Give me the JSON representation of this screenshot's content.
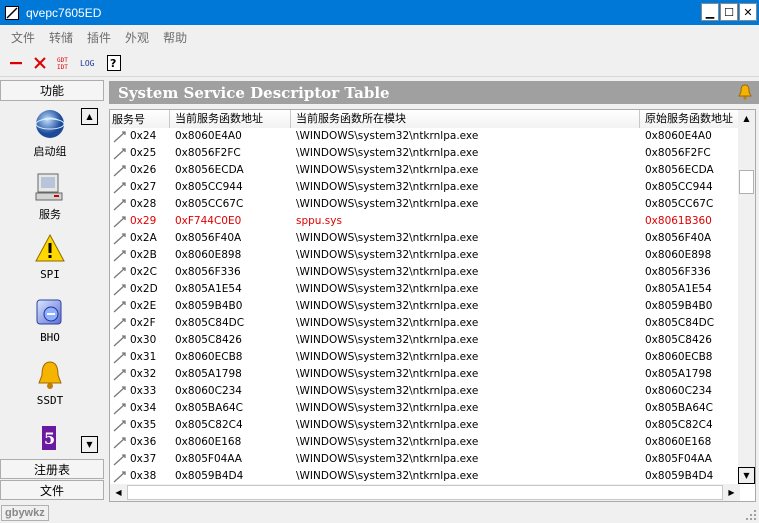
{
  "window": {
    "title": "qvepc7605ED",
    "min": "▁",
    "max": "☐",
    "close": "✕"
  },
  "menu": [
    "文件",
    "转储",
    "插件",
    "外观",
    "帮助"
  ],
  "toolbar": {
    "gdt_idt": "GDT IDT",
    "log": "LOG",
    "help": "?"
  },
  "sidebar": {
    "header": "功能",
    "items": [
      {
        "label": "启动组",
        "icon": "globe-icon"
      },
      {
        "label": "服务",
        "icon": "computer-icon"
      },
      {
        "label": "SPI",
        "icon": "warning-icon"
      },
      {
        "label": "BHO",
        "icon": "browser-icon"
      },
      {
        "label": "SSDT",
        "icon": "bell-icon"
      },
      {
        "label": "",
        "icon": "purple-app-icon"
      }
    ],
    "footer": [
      "注册表",
      "文件"
    ]
  },
  "panel": {
    "title": "System Service Descriptor Table",
    "columns": [
      "服务号",
      "当前服务函数地址",
      "当前服务函数所在模块",
      "原始服务函数地址"
    ],
    "rows": [
      {
        "id": "0x24",
        "cur": "0x8060E4A0",
        "module": "\\WINDOWS\\system32\\ntkrnlpa.exe",
        "orig": "0x8060E4A0",
        "hooked": false
      },
      {
        "id": "0x25",
        "cur": "0x8056F2FC",
        "module": "\\WINDOWS\\system32\\ntkrnlpa.exe",
        "orig": "0x8056F2FC",
        "hooked": false
      },
      {
        "id": "0x26",
        "cur": "0x8056ECDA",
        "module": "\\WINDOWS\\system32\\ntkrnlpa.exe",
        "orig": "0x8056ECDA",
        "hooked": false
      },
      {
        "id": "0x27",
        "cur": "0x805CC944",
        "module": "\\WINDOWS\\system32\\ntkrnlpa.exe",
        "orig": "0x805CC944",
        "hooked": false
      },
      {
        "id": "0x28",
        "cur": "0x805CC67C",
        "module": "\\WINDOWS\\system32\\ntkrnlpa.exe",
        "orig": "0x805CC67C",
        "hooked": false
      },
      {
        "id": "0x29",
        "cur": "0xF744C0E0",
        "module": "sppu.sys",
        "orig": "0x8061B360",
        "hooked": true
      },
      {
        "id": "0x2A",
        "cur": "0x8056F40A",
        "module": "\\WINDOWS\\system32\\ntkrnlpa.exe",
        "orig": "0x8056F40A",
        "hooked": false
      },
      {
        "id": "0x2B",
        "cur": "0x8060E898",
        "module": "\\WINDOWS\\system32\\ntkrnlpa.exe",
        "orig": "0x8060E898",
        "hooked": false
      },
      {
        "id": "0x2C",
        "cur": "0x8056F336",
        "module": "\\WINDOWS\\system32\\ntkrnlpa.exe",
        "orig": "0x8056F336",
        "hooked": false
      },
      {
        "id": "0x2D",
        "cur": "0x805A1E54",
        "module": "\\WINDOWS\\system32\\ntkrnlpa.exe",
        "orig": "0x805A1E54",
        "hooked": false
      },
      {
        "id": "0x2E",
        "cur": "0x8059B4B0",
        "module": "\\WINDOWS\\system32\\ntkrnlpa.exe",
        "orig": "0x8059B4B0",
        "hooked": false
      },
      {
        "id": "0x2F",
        "cur": "0x805C84DC",
        "module": "\\WINDOWS\\system32\\ntkrnlpa.exe",
        "orig": "0x805C84DC",
        "hooked": false
      },
      {
        "id": "0x30",
        "cur": "0x805C8426",
        "module": "\\WINDOWS\\system32\\ntkrnlpa.exe",
        "orig": "0x805C8426",
        "hooked": false
      },
      {
        "id": "0x31",
        "cur": "0x8060ECB8",
        "module": "\\WINDOWS\\system32\\ntkrnlpa.exe",
        "orig": "0x8060ECB8",
        "hooked": false
      },
      {
        "id": "0x32",
        "cur": "0x805A1798",
        "module": "\\WINDOWS\\system32\\ntkrnlpa.exe",
        "orig": "0x805A1798",
        "hooked": false
      },
      {
        "id": "0x33",
        "cur": "0x8060C234",
        "module": "\\WINDOWS\\system32\\ntkrnlpa.exe",
        "orig": "0x8060C234",
        "hooked": false
      },
      {
        "id": "0x34",
        "cur": "0x805BA64C",
        "module": "\\WINDOWS\\system32\\ntkrnlpa.exe",
        "orig": "0x805BA64C",
        "hooked": false
      },
      {
        "id": "0x35",
        "cur": "0x805C82C4",
        "module": "\\WINDOWS\\system32\\ntkrnlpa.exe",
        "orig": "0x805C82C4",
        "hooked": false
      },
      {
        "id": "0x36",
        "cur": "0x8060E168",
        "module": "\\WINDOWS\\system32\\ntkrnlpa.exe",
        "orig": "0x8060E168",
        "hooked": false
      },
      {
        "id": "0x37",
        "cur": "0x805F04AA",
        "module": "\\WINDOWS\\system32\\ntkrnlpa.exe",
        "orig": "0x805F04AA",
        "hooked": false
      },
      {
        "id": "0x38",
        "cur": "0x8059B4D4",
        "module": "\\WINDOWS\\system32\\ntkrnlpa.exe",
        "orig": "0x8059B4D4",
        "hooked": false
      }
    ]
  },
  "status": {
    "text": "gbywkz"
  },
  "colors": {
    "titlebar": "#0078d7",
    "hooked": "#e00000",
    "panel_header": "#a0a0a0"
  }
}
